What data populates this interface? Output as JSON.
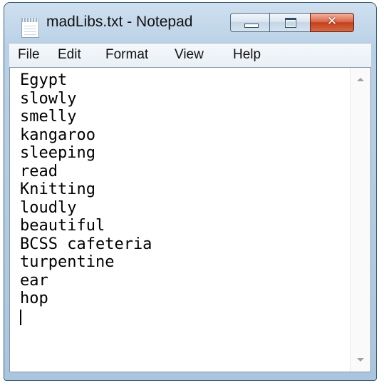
{
  "window": {
    "title": "madLibs.txt - Notepad",
    "icon": "notepad-icon",
    "controls": {
      "minimize": "minimize-icon",
      "maximize": "maximize-icon",
      "close_glyph": "✕"
    }
  },
  "menu": [
    "File",
    "Edit",
    "Format",
    "View",
    "Help"
  ],
  "editor": {
    "lines": [
      "Egypt",
      "slowly",
      "smelly",
      "kangaroo",
      "sleeping",
      "read",
      "Knitting",
      "loudly",
      "beautiful",
      "BCSS cafeteria",
      "turpentine",
      "ear",
      "hop"
    ]
  },
  "colors": {
    "chrome": "#b9d1e6",
    "close_button": "#c4411d"
  }
}
